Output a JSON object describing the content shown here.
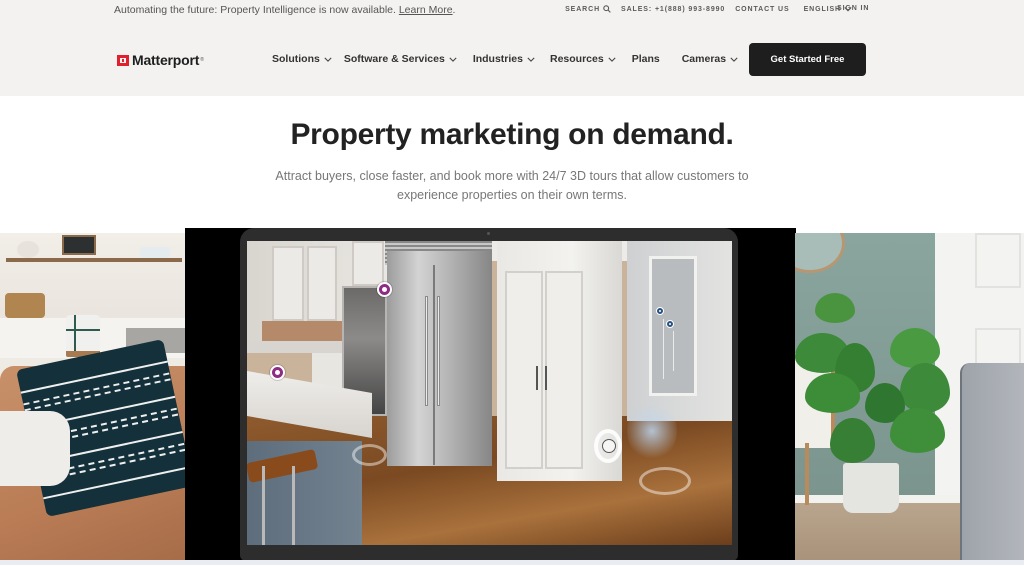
{
  "topbar": {
    "announcement": "Automating the future: Property Intelligence is now available.",
    "announcement_link": "Learn More",
    "announcement_suffix": ".",
    "search_label": "SEARCH",
    "sales_label": "SALES: +1(888) 993-8990",
    "contact_label": "CONTACT US",
    "language_label": "ENGLISH",
    "signin_label": "SIGN IN"
  },
  "header": {
    "brand_name": "Matterport",
    "brand_mark": "®",
    "nav": [
      {
        "label": "Solutions",
        "has_dropdown": true
      },
      {
        "label": "Software & Services",
        "has_dropdown": true
      },
      {
        "label": "Industries",
        "has_dropdown": true
      },
      {
        "label": "Resources",
        "has_dropdown": true
      },
      {
        "label": "Plans",
        "has_dropdown": false
      },
      {
        "label": "Cameras",
        "has_dropdown": true
      }
    ],
    "cta_label": "Get Started Free"
  },
  "hero": {
    "title": "Property marketing on demand.",
    "subtitle": "Attract buyers, close faster, and book more with 24/7 3D tours that allow customers to experience properties on their own terms."
  },
  "media": {
    "left_image": "living-room-sofa-with-patterned-cushion",
    "center_video": "3d-kitchen-tour-in-laptop",
    "right_image": "fiddle-leaf-fig-plant-by-wall"
  },
  "colors": {
    "brand_red": "#e0202c",
    "header_bg": "#f4f2f0",
    "cta_bg": "#1e1e1e",
    "hotspot_magenta": "#8e2b84",
    "hotspot_blue": "#2a5280"
  }
}
